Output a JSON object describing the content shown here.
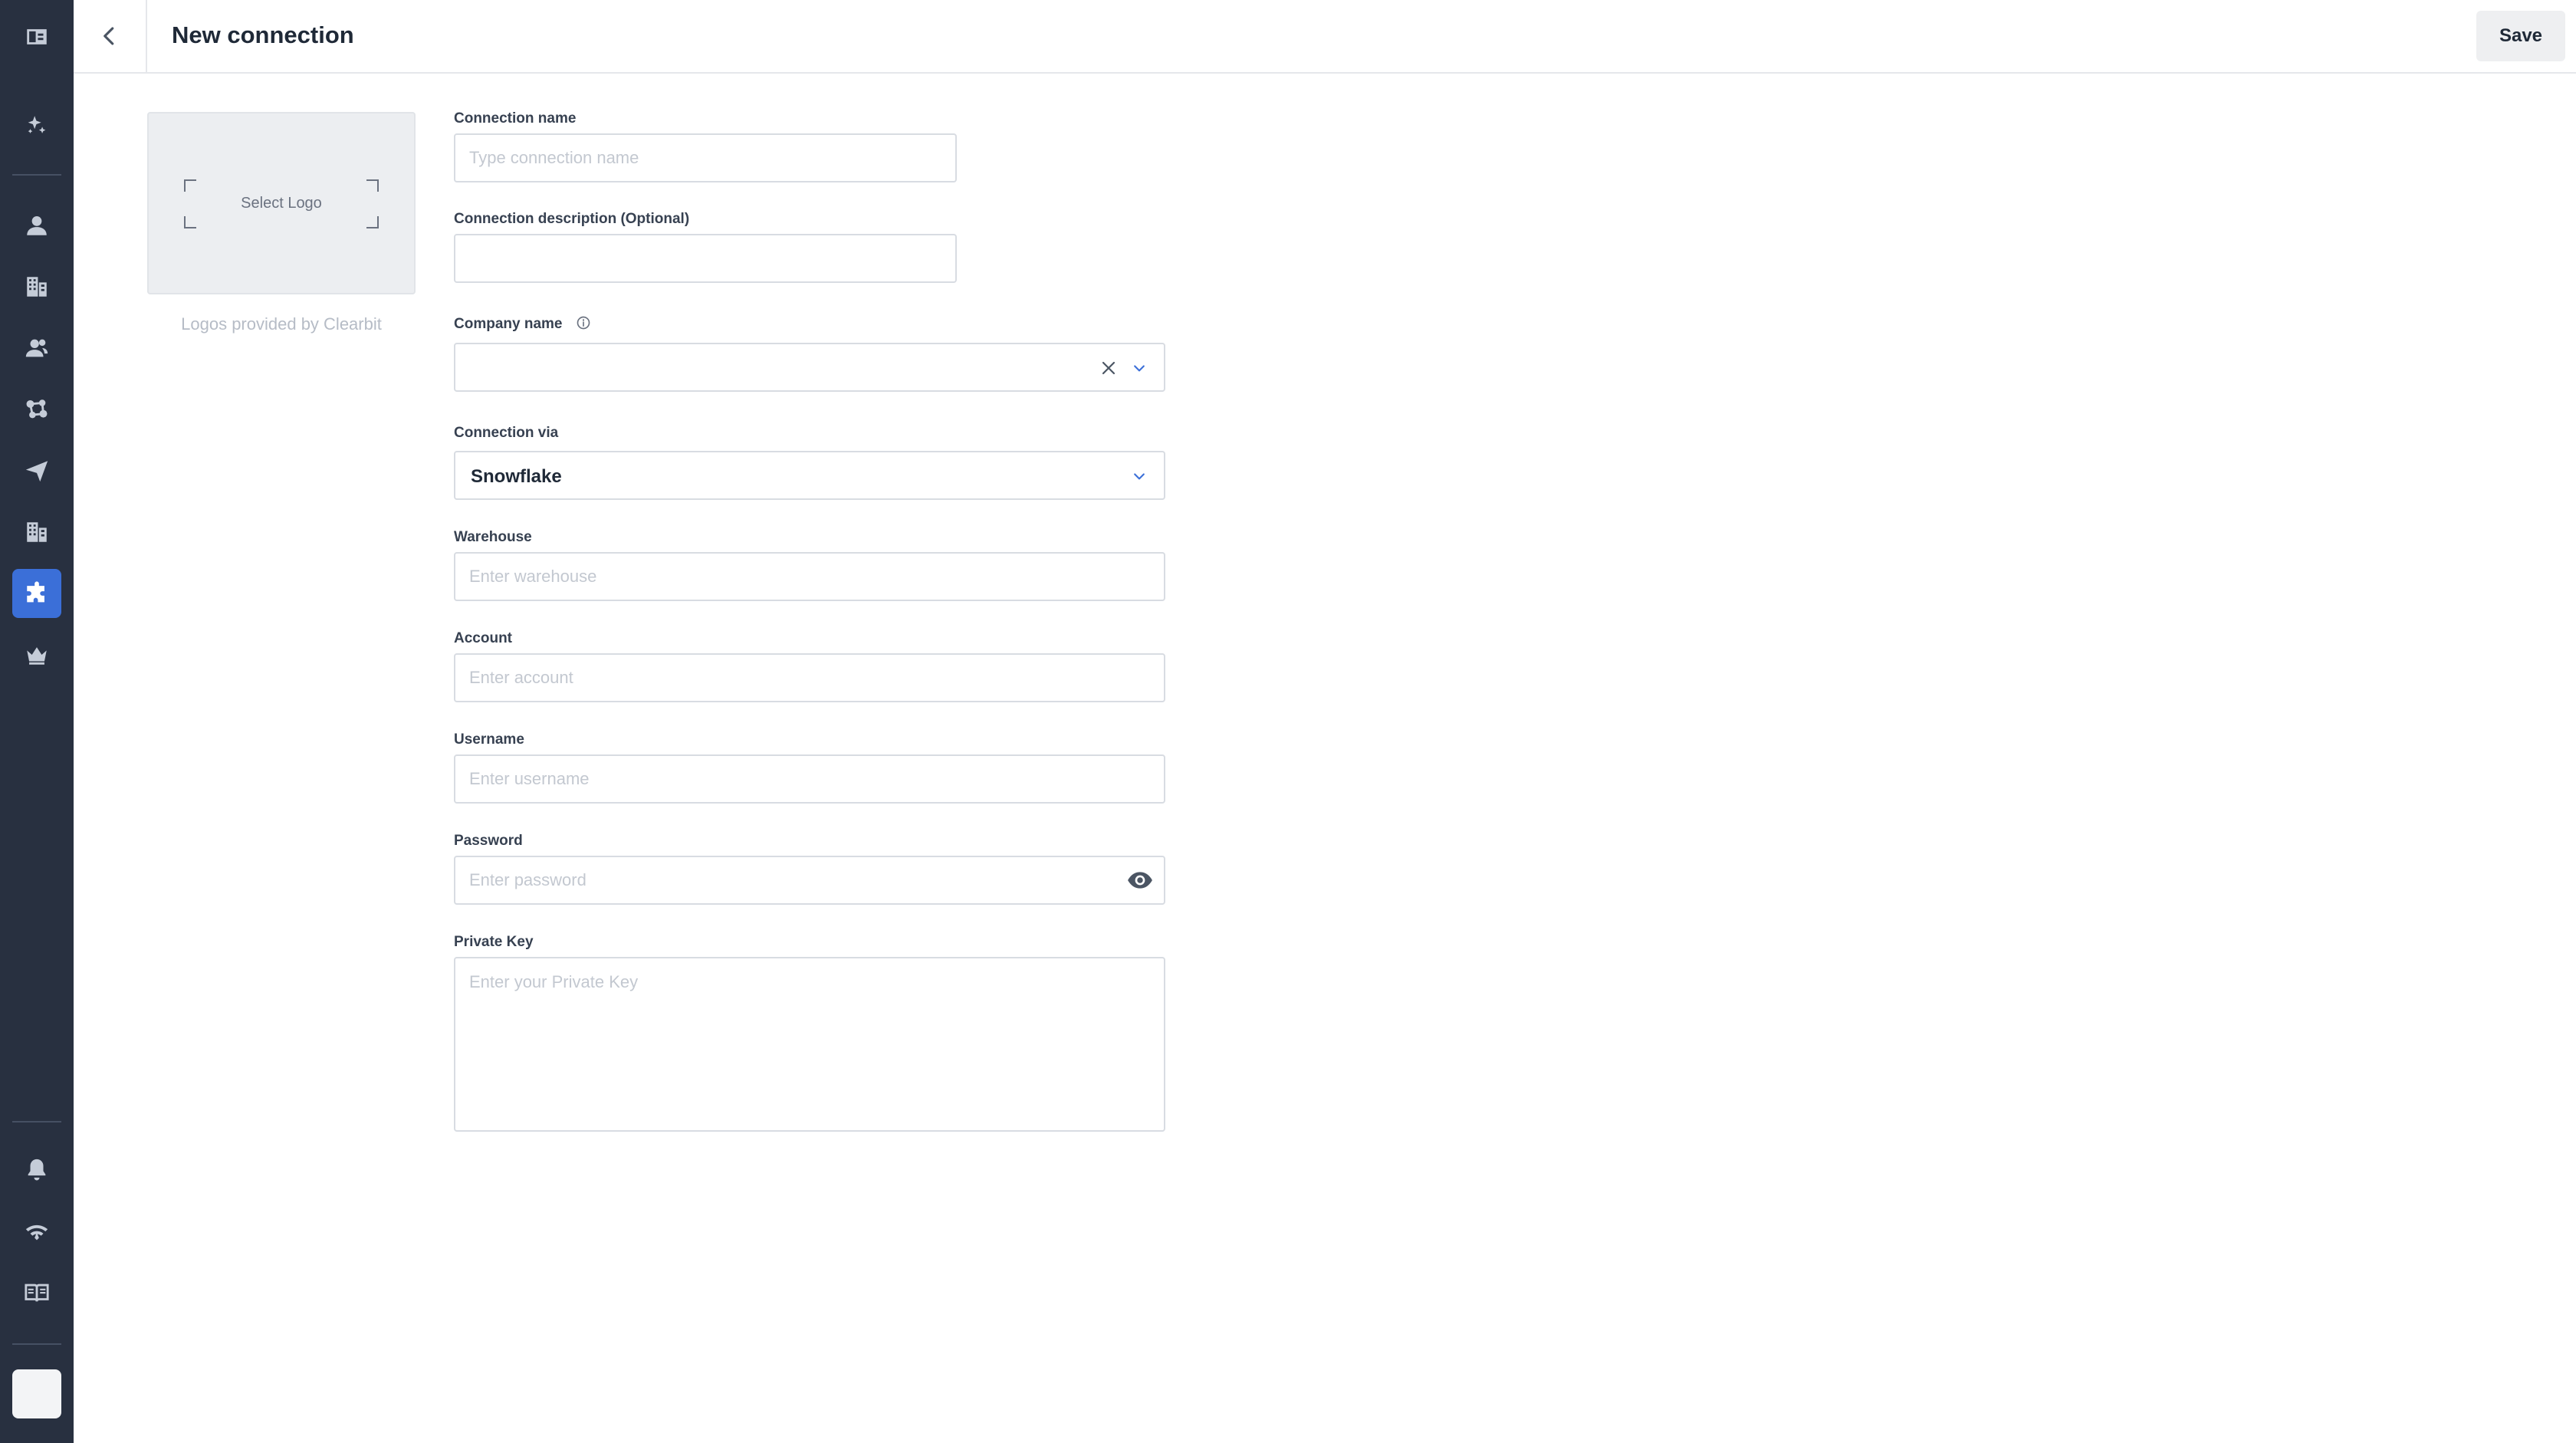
{
  "header": {
    "title": "New connection",
    "save_label": "Save"
  },
  "logo": {
    "select_label": "Select Logo",
    "caption": "Logos provided by Clearbit"
  },
  "form": {
    "connection_name": {
      "label": "Connection name",
      "placeholder": "Type connection name",
      "value": ""
    },
    "connection_description": {
      "label": "Connection description (Optional)",
      "placeholder": "",
      "value": ""
    },
    "company_name": {
      "label": "Company name",
      "value": ""
    },
    "connection_via": {
      "label": "Connection via",
      "value": "Snowflake"
    },
    "warehouse": {
      "label": "Warehouse",
      "placeholder": "Enter warehouse",
      "value": ""
    },
    "account": {
      "label": "Account",
      "placeholder": "Enter account",
      "value": ""
    },
    "username": {
      "label": "Username",
      "placeholder": "Enter username",
      "value": ""
    },
    "password": {
      "label": "Password",
      "placeholder": "Enter password",
      "value": ""
    },
    "private_key": {
      "label": "Private Key",
      "placeholder": "Enter your Private Key",
      "value": ""
    }
  },
  "sidebar": {
    "items": [
      {
        "icon": "collapse-sidebar-icon"
      },
      {
        "icon": "sparkles-icon"
      },
      {
        "icon": "person-icon"
      },
      {
        "icon": "buildings-icon"
      },
      {
        "icon": "people-icon"
      },
      {
        "icon": "network-icon"
      },
      {
        "icon": "send-icon"
      },
      {
        "icon": "building-icon"
      },
      {
        "icon": "puzzle-icon",
        "active": true
      },
      {
        "icon": "crown-icon"
      },
      {
        "icon": "bell-icon"
      },
      {
        "icon": "signal-icon"
      },
      {
        "icon": "book-icon"
      }
    ]
  },
  "colors": {
    "sidebar_bg": "#283040",
    "accent": "#3b6fd8",
    "chevron": "#3b6fd8"
  }
}
